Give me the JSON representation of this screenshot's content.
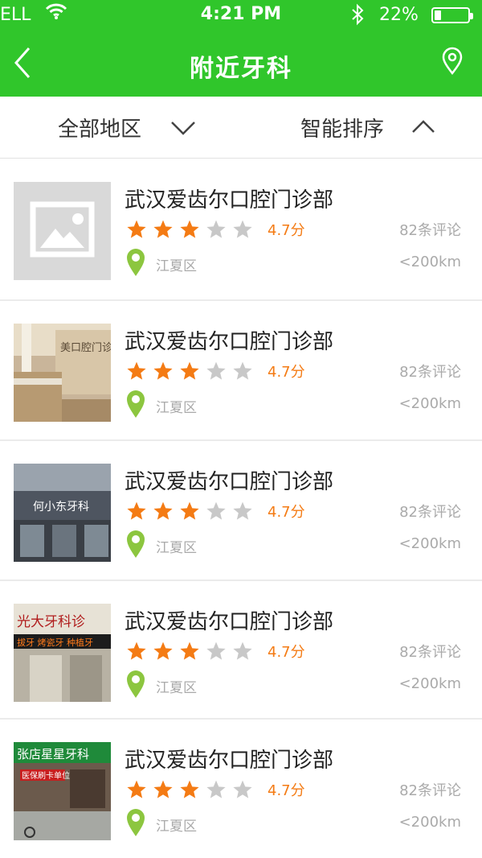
{
  "status_bar": {
    "carrier": "ELL",
    "time": "4:21 PM",
    "battery": "22%",
    "bluetooth_icon": "bluetooth-icon",
    "wifi_icon": "wifi-icon"
  },
  "header": {
    "title": "附近牙科",
    "back_icon": "chevron-left-icon",
    "location_icon": "map-pin-icon",
    "color": "#30c62b"
  },
  "filters": {
    "area_label": "全部地区",
    "area_icon": "chevron-down-icon",
    "sort_label": "智能排序",
    "sort_icon": "chevron-up-icon"
  },
  "clinics": [
    {
      "name": "武汉爱齿尔口腔门诊部",
      "rating_stars": 3,
      "max_stars": 5,
      "score": "4.7分",
      "reviews": "82条评论",
      "district": "江夏区",
      "distance": "<200km",
      "image": "image-placeholder-icon"
    },
    {
      "name": "武汉爱齿尔口腔门诊部",
      "rating_stars": 3,
      "max_stars": 5,
      "score": "4.7分",
      "reviews": "82条评论",
      "district": "江夏区",
      "distance": "<200km",
      "image": "clinic-photo-reception"
    },
    {
      "name": "武汉爱齿尔口腔门诊部",
      "rating_stars": 3,
      "max_stars": 5,
      "score": "4.7分",
      "reviews": "82条评论",
      "district": "江夏区",
      "distance": "<200km",
      "image": "clinic-photo-storefront"
    },
    {
      "name": "武汉爱齿尔口腔门诊部",
      "rating_stars": 3,
      "max_stars": 5,
      "score": "4.7分",
      "reviews": "82条评论",
      "district": "江夏区",
      "distance": "<200km",
      "image": "clinic-photo-shopfront"
    },
    {
      "name": "武汉爱齿尔口腔门诊部",
      "rating_stars": 3,
      "max_stars": 5,
      "score": "4.7分",
      "reviews": "82条评论",
      "district": "江夏区",
      "distance": "<200km",
      "image": "clinic-photo-street"
    }
  ],
  "colors": {
    "star_filled": "#f47b14",
    "star_empty": "#c8c8c8",
    "pin": "#8cc63f",
    "muted_text": "#aaaaaa"
  }
}
